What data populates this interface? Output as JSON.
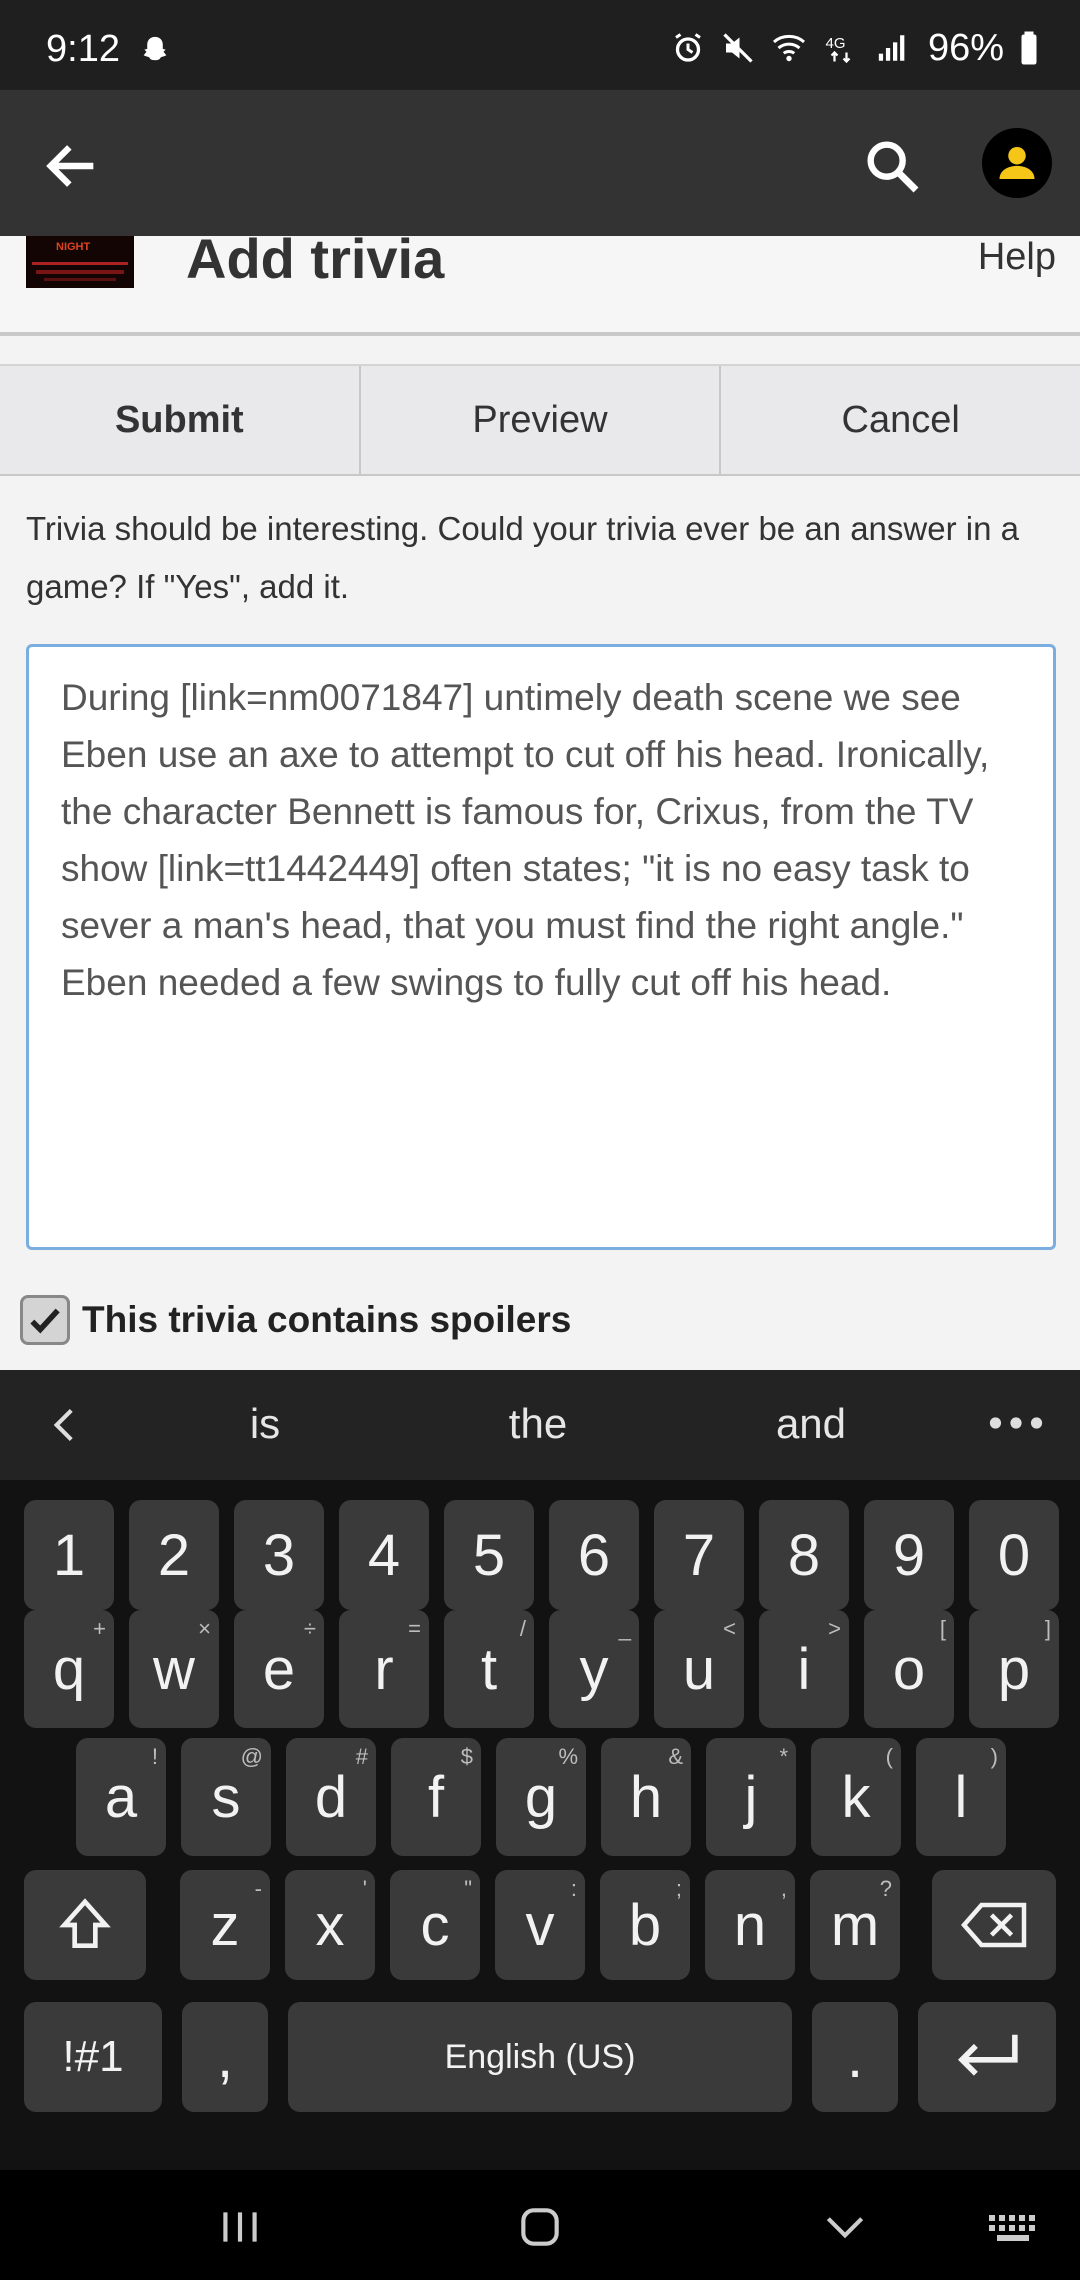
{
  "status_bar": {
    "time": "9:12",
    "battery": "96%"
  },
  "app_bar": {
    "back_icon": "arrow-left-icon",
    "search_icon": "search-icon",
    "account_icon": "person-icon"
  },
  "page": {
    "title": "Add trivia",
    "help": "Help"
  },
  "actions": {
    "submit": "Submit",
    "preview": "Preview",
    "cancel": "Cancel"
  },
  "intro": "Trivia should be interesting. Could your trivia ever be an answer in a game? If \"Yes\", add it.",
  "trivia_text": "During [link=nm0071847] untimely death scene we see Eben use an axe to attempt to cut off his head. Ironically, the character Bennett is famous for, Crixus, from the TV show [link=tt1442449] often states; \"it is no easy task to sever a man's head, that you must find the right angle.\" Eben needed a few swings to fully cut off his head.",
  "spoiler": {
    "label": "This trivia contains spoilers",
    "checked": true
  },
  "keyboard": {
    "suggestions": [
      "is",
      "the",
      "and"
    ],
    "numbers": [
      "1",
      "2",
      "3",
      "4",
      "5",
      "6",
      "7",
      "8",
      "9",
      "0"
    ],
    "row_q": [
      {
        "k": "q",
        "h": "+"
      },
      {
        "k": "w",
        "h": "×"
      },
      {
        "k": "e",
        "h": "÷"
      },
      {
        "k": "r",
        "h": "="
      },
      {
        "k": "t",
        "h": "/"
      },
      {
        "k": "y",
        "h": "_"
      },
      {
        "k": "u",
        "h": "<"
      },
      {
        "k": "i",
        "h": ">"
      },
      {
        "k": "o",
        "h": "["
      },
      {
        "k": "p",
        "h": "]"
      }
    ],
    "row_a": [
      {
        "k": "a",
        "h": "!"
      },
      {
        "k": "s",
        "h": "@"
      },
      {
        "k": "d",
        "h": "#"
      },
      {
        "k": "f",
        "h": "$"
      },
      {
        "k": "g",
        "h": "%"
      },
      {
        "k": "h",
        "h": "&"
      },
      {
        "k": "j",
        "h": "*"
      },
      {
        "k": "k",
        "h": "("
      },
      {
        "k": "l",
        "h": ")"
      }
    ],
    "row_z": [
      {
        "k": "z",
        "h": "-"
      },
      {
        "k": "x",
        "h": "'"
      },
      {
        "k": "c",
        "h": "\""
      },
      {
        "k": "v",
        "h": ":"
      },
      {
        "k": "b",
        "h": ";"
      },
      {
        "k": "n",
        "h": ","
      },
      {
        "k": "m",
        "h": "?"
      }
    ],
    "symbols_key": "!#1",
    "comma_key": ",",
    "space_label": "English (US)",
    "period_key": "."
  }
}
